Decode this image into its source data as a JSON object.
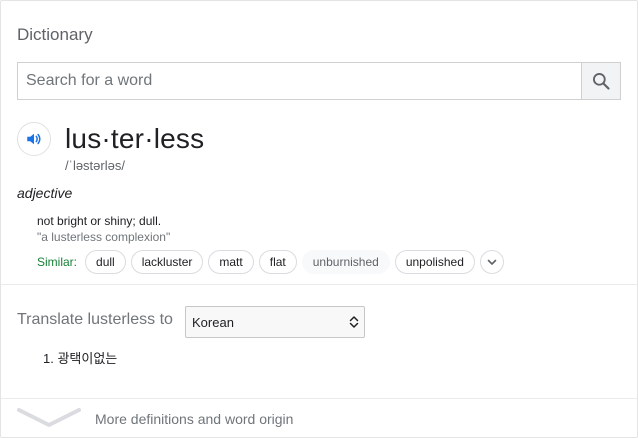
{
  "dictionary": {
    "title": "Dictionary",
    "search": {
      "placeholder": "Search for a word",
      "value": "",
      "button_icon": "search-icon"
    },
    "entry": {
      "speaker_icon": "speaker-icon",
      "headword": "lus·ter·less",
      "phonetic": "/ˈləstərləs/",
      "part_of_speech": "adjective",
      "definition": "not bright or shiny; dull.",
      "example": "\"a lusterless complexion\"",
      "similar_label": "Similar:",
      "similar": [
        "dull",
        "lackluster",
        "matt",
        "flat",
        "unburnished",
        "unpolished"
      ],
      "expand_icon": "chevron-down-icon"
    },
    "translate": {
      "label": "Translate lusterless to",
      "language": "Korean",
      "results": [
        "1. 광택이없는"
      ]
    },
    "more": {
      "label": "More definitions and word origin",
      "icon": "chevron-down-icon"
    },
    "colors": {
      "similar_label": "#188038",
      "speaker": "#1a73e8",
      "muted": "#70757a"
    }
  }
}
